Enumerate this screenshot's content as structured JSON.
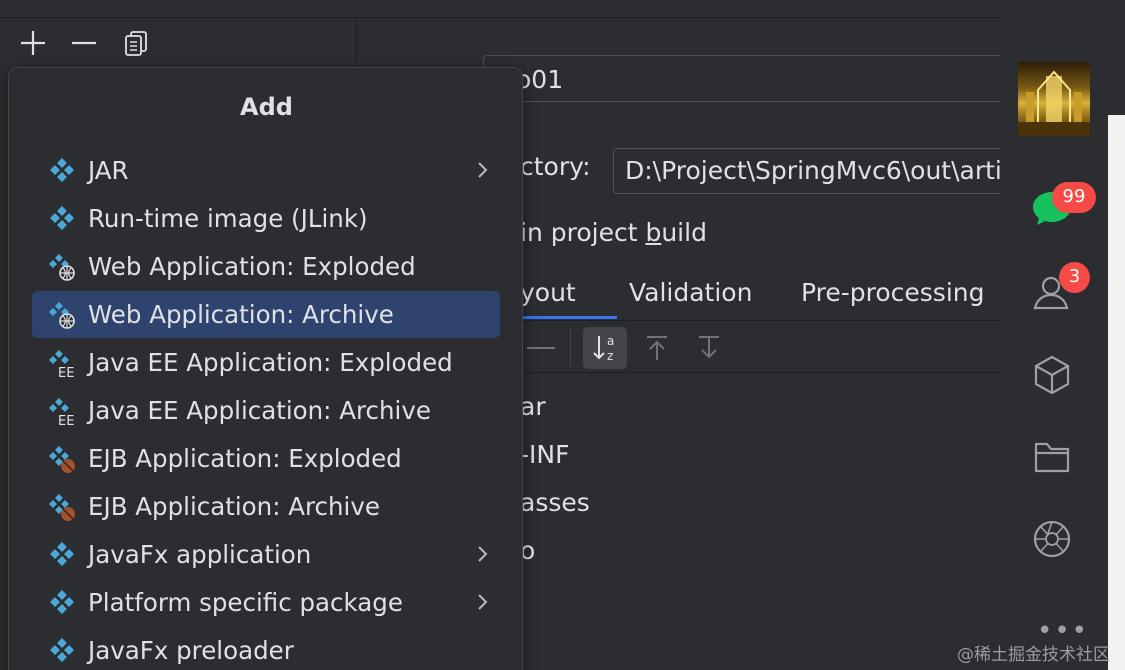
{
  "ide": {
    "toolbar": {
      "add_icon": "plus-icon",
      "remove_icon": "minus-icon",
      "copy_icon": "copy-icon"
    },
    "name_value": "o01",
    "output_dir_label": "ctory:",
    "output_dir_value": "D:\\Project\\SpringMvc6\\out\\arti",
    "build_checkbox_text_before": "in project ",
    "build_checkbox_mnemonic": "b",
    "build_checkbox_text_after": "uild",
    "tabs": [
      {
        "label": "yout"
      },
      {
        "label": "Validation"
      },
      {
        "label": "Pre-processing"
      }
    ],
    "layout_tools": [
      "remove-icon",
      "sort-alpha-icon",
      "move-up-icon",
      "move-down-icon"
    ],
    "tree_items": [
      "ar",
      "-INF",
      "asses",
      "o"
    ]
  },
  "popup": {
    "title": "Add",
    "items": [
      {
        "label": "JAR",
        "icon": "artifact-icon",
        "submenu": true
      },
      {
        "label": "Run-time image (JLink)",
        "icon": "artifact-icon",
        "submenu": false
      },
      {
        "label": "Web Application: Exploded",
        "icon": "web-artifact-icon",
        "submenu": false
      },
      {
        "label": "Web Application: Archive",
        "icon": "web-artifact-icon",
        "submenu": false,
        "selected": true
      },
      {
        "label": "Java EE Application: Exploded",
        "icon": "javaee-artifact-icon",
        "submenu": false
      },
      {
        "label": "Java EE Application: Archive",
        "icon": "javaee-artifact-icon",
        "submenu": false
      },
      {
        "label": "EJB Application: Exploded",
        "icon": "ejb-artifact-icon",
        "submenu": false
      },
      {
        "label": "EJB Application: Archive",
        "icon": "ejb-artifact-icon",
        "submenu": false
      },
      {
        "label": "JavaFx application",
        "icon": "artifact-icon",
        "submenu": true
      },
      {
        "label": "Platform specific package",
        "icon": "artifact-icon",
        "submenu": true
      },
      {
        "label": "JavaFx preloader",
        "icon": "artifact-icon",
        "submenu": false
      }
    ]
  },
  "sidebar": {
    "messages_badge": "99",
    "contacts_badge": "3",
    "icons": [
      "avatar",
      "chat-icon",
      "contacts-icon",
      "cube-icon",
      "folder-icon",
      "aperture-icon",
      "more-icon"
    ]
  },
  "watermark": "@稀土掘金技术社区",
  "colors": {
    "background": "#2b2d30",
    "selection": "#2e436e",
    "accent": "#3574f0",
    "badge": "#f54a45",
    "artifact_icon": "#4aa8d8"
  }
}
